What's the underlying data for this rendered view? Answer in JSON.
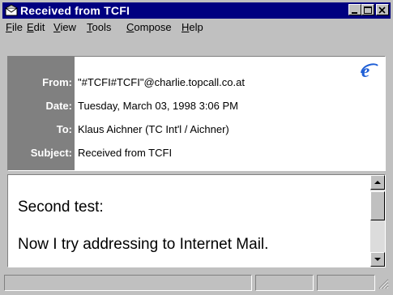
{
  "window": {
    "title": "Received from TCFI"
  },
  "menubar": {
    "items": [
      {
        "label": "File",
        "key": "F",
        "rest": "ile"
      },
      {
        "label": "Edit",
        "key": "E",
        "rest": "dit"
      },
      {
        "label": "View",
        "key": "V",
        "rest": "iew"
      },
      {
        "label": "Tools",
        "key": "T",
        "rest": "ools"
      },
      {
        "label": "Compose",
        "key": "C",
        "rest": "ompose"
      },
      {
        "label": "Help",
        "key": "H",
        "rest": "elp"
      }
    ]
  },
  "header": {
    "from_label": "From:",
    "from_value": "\"#TCFI#TCFI\"@charlie.topcall.co.at",
    "date_label": "Date:",
    "date_value": "Tuesday, March 03, 1998 3:06 PM",
    "to_label": "To:",
    "to_value": "Klaus Aichner (TC Int'l / Aichner)",
    "subject_label": "Subject:",
    "subject_value": "Received from TCFI"
  },
  "body": {
    "line1": "Second test:",
    "line2": "Now I try addressing to Internet Mail."
  },
  "icons": {
    "title_icon": "mail-envelope-icon",
    "browser_icon": "internet-explorer-icon"
  },
  "colors": {
    "titlebar": "#000080",
    "label_panel": "#808080",
    "chrome": "#c0c0c0",
    "ie_blue": "#1f5fd6"
  }
}
